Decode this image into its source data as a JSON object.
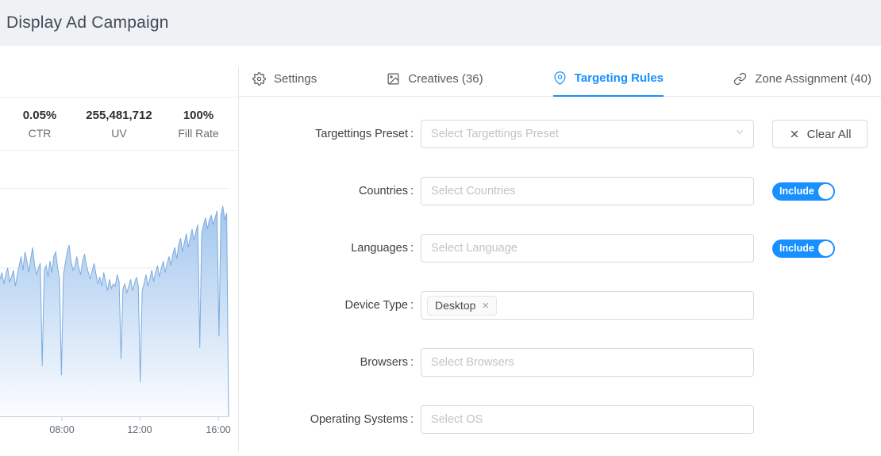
{
  "header": {
    "title": "Display Ad Campaign"
  },
  "stats": [
    {
      "value": "0.05%",
      "label": "CTR"
    },
    {
      "value": "255,481,712",
      "label": "UV"
    },
    {
      "value": "100%",
      "label": "Fill Rate"
    }
  ],
  "tabs": [
    {
      "label": "Settings"
    },
    {
      "label": "Creatives (36)"
    },
    {
      "label": "Targeting Rules"
    },
    {
      "label": "Zone Assignment (40)"
    }
  ],
  "form": {
    "colon": ":",
    "include_label": "Include",
    "clear_all_label": "Clear All",
    "rows": {
      "preset": {
        "label": "Targettings Preset",
        "placeholder": "Select Targettings Preset"
      },
      "countries": {
        "label": "Countries",
        "placeholder": "Select Countries"
      },
      "languages": {
        "label": "Languages",
        "placeholder": "Select Language"
      },
      "device_type": {
        "label": "Device Type"
      },
      "browsers": {
        "label": "Browsers",
        "placeholder": "Select Browsers"
      },
      "os": {
        "label": "Operating Systems",
        "placeholder": "Select OS"
      }
    },
    "device_tag": {
      "label": "Desktop",
      "remove": "×"
    }
  },
  "colors": {
    "accent": "#1890ff",
    "toggle_on": "#1890ff",
    "chart_line": "#7dabde",
    "chart_fill_top": "#a6c8ee",
    "header_bg": "#eff1f4"
  },
  "chart_data": {
    "type": "area",
    "title": "",
    "xlabel": "",
    "ylabel": "",
    "legend": "none",
    "grid": true,
    "ylim": [
      0,
      100
    ],
    "gridline_value": 65,
    "x_ticks": [
      {
        "label": "08:00",
        "frac": 0.271
      },
      {
        "label": "12:00",
        "frac": 0.611
      },
      {
        "label": "16:00",
        "frac": 0.955
      }
    ],
    "values": [
      60,
      63,
      58,
      62,
      65,
      59,
      61,
      64,
      57,
      62,
      66,
      70,
      64,
      72,
      68,
      63,
      69,
      74,
      66,
      62,
      65,
      67,
      22,
      64,
      66,
      61,
      68,
      63,
      70,
      72,
      65,
      60,
      18,
      62,
      67,
      72,
      75,
      68,
      64,
      66,
      70,
      65,
      62,
      68,
      71,
      66,
      63,
      60,
      64,
      67,
      62,
      58,
      61,
      57,
      63,
      59,
      55,
      60,
      56,
      58,
      57,
      62,
      59,
      25,
      56,
      58,
      54,
      57,
      60,
      55,
      58,
      61,
      57,
      15,
      55,
      58,
      62,
      57,
      60,
      64,
      59,
      63,
      66,
      61,
      65,
      68,
      63,
      67,
      70,
      66,
      71,
      74,
      69,
      75,
      78,
      72,
      76,
      80,
      74,
      78,
      82,
      77,
      81,
      84,
      30,
      80,
      84,
      87,
      82,
      86,
      88,
      84,
      87,
      90,
      35,
      88,
      92,
      86,
      89,
      0
    ]
  }
}
